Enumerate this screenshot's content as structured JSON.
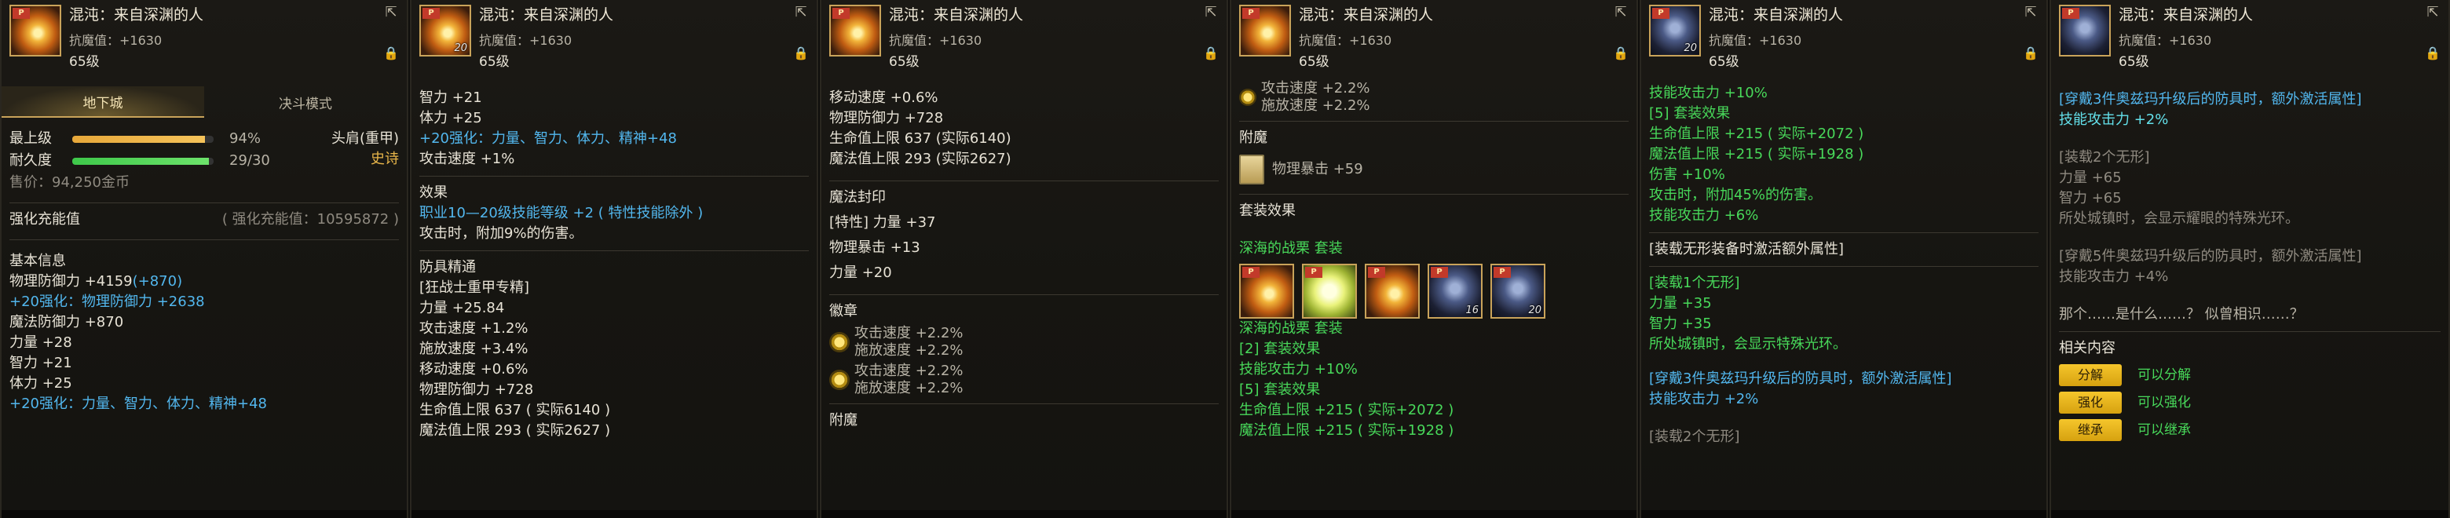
{
  "item": {
    "title": "混沌：来自深渊的人",
    "resist": "抗魔值：+1630",
    "level": "65级",
    "thumb_num": "20",
    "thumb_badge": "P"
  },
  "p1": {
    "tabs": [
      "地下城",
      "决斗模式"
    ],
    "max_label": "最上级",
    "max_pct": "94%",
    "max_value": 0.94,
    "dur_label": "耐久度",
    "dur_val": "29/30",
    "dur_value": 0.967,
    "slot_type": "头肩(重甲)",
    "rarity": "史诗",
    "price": "售价：94,250金币",
    "reinforce_label": "强化充能值",
    "reinforce_val": "( 强化充能值：10595872 )",
    "basic_title": "基本信息",
    "phys_def": "物理防御力 +4159",
    "phys_def_bonus": "(+870)",
    "enh20_phys": "+20强化：物理防御力 +2638",
    "mag_def": "魔法防御力 +870",
    "str": "力量 +28",
    "int": "智力 +21",
    "vit": "体力 +25",
    "enh20_stats": "+20强化：力量、智力、体力、精神+48"
  },
  "p2": {
    "int": "智力 +21",
    "vit": "体力 +25",
    "enh20_stats": "+20强化：力量、智力、体力、精神+48",
    "atk_speed": "攻击速度 +1%",
    "effect_title": "效果",
    "effect1": "职业10—20级技能等级 +2 ( 特性技能除外 )",
    "effect2": "攻击时，附加9%的伤害。",
    "refine_title": "防具精通",
    "refine_sub": "[狂战士重甲专精]",
    "str": "力量 +25.84",
    "atk": "攻击速度 +1.2%",
    "cast": "施放速度 +3.4%",
    "move": "移动速度 +0.6%",
    "phys": "物理防御力 +728",
    "hp": "生命值上限 637 ( 实际6140 )",
    "mp": "魔法值上限 293 ( 实际2627 )"
  },
  "p3": {
    "move": "移动速度 +0.6%",
    "phys": "物理防御力 +728",
    "hp": "生命值上限 637 (实际6140)",
    "mp": "魔法值上限 293 (实际2627)",
    "seal_title": "魔法封印",
    "seal1": "[特性] 力量 +37",
    "seal2": "物理暴击 +13",
    "seal3": "力量 +20",
    "emblem_title": "徽章",
    "emb1a": "攻击速度 +2.2%",
    "emb1b": "施放速度 +2.2%",
    "emb2a": "攻击速度 +2.2%",
    "emb2b": "施放速度 +2.2%",
    "enchant_title": "附魔"
  },
  "p4": {
    "top1": "攻击速度 +2.2%",
    "top2": "施放速度 +2.2%",
    "enchant_title": "附魔",
    "enchant_val": "物理暴击 +59",
    "set_title": "套装效果",
    "set_name": "深海的战栗  套装",
    "set_nums": [
      "",
      "",
      "",
      "16",
      "20"
    ],
    "set_name2": "深海的战栗  套装",
    "s2": "[2] 套装效果",
    "s2a": "技能攻击力 +10%",
    "s5": "[5] 套装效果",
    "s5a": "生命值上限 +215 ( 实际+2072 )",
    "s5b": "魔法值上限 +215 ( 实际+1928 )"
  },
  "p5": {
    "a1": "技能攻击力 +10%",
    "a2": "[5] 套装效果",
    "a3": "生命值上限 +215 ( 实际+2072 )",
    "a4": "魔法值上限 +215 ( 实际+1928 )",
    "a5": "伤害 +10%",
    "a6": "攻击时，附加45%的伤害。",
    "a7": "技能攻击力 +6%",
    "b1": "[装载无形装备时激活额外属性]",
    "b2": "[装载1个无形]",
    "b3": "力量 +35",
    "b4": "智力 +35",
    "b5": "所处城镇时，会显示特殊光环。",
    "c1": "[穿戴3件奥兹玛升级后的防具时，额外激活属性]",
    "c2": "技能攻击力 +2%",
    "c3": "[装载2个无形]"
  },
  "p6": {
    "a1": "[穿戴3件奥兹玛升级后的防具时，额外激活属性]",
    "a2": "技能攻击力 +2%",
    "b1": "[装载2个无形]",
    "b2": "力量 +65",
    "b3": "智力 +65",
    "b4": "所处城镇时，会显示耀眼的特殊光环。",
    "c1": "[穿戴5件奥兹玛升级后的防具时，额外激活属性]",
    "c2": "技能攻击力 +4%",
    "d1": "那个……是什么……？ 似曾相识……？",
    "rel_title": "相关内容",
    "btns": [
      "分解",
      "强化",
      "继承"
    ],
    "notes": [
      "可以分解",
      "可以强化",
      "可以继承"
    ]
  }
}
